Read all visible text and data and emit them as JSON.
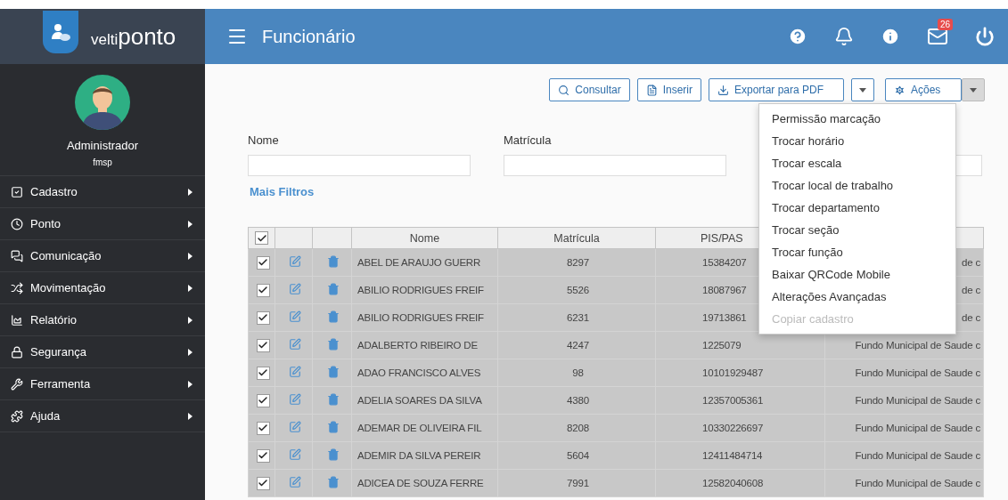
{
  "brand": {
    "prefix": "velti",
    "name": "ponto"
  },
  "user": {
    "name": "Administrador",
    "org": "fmsp"
  },
  "sidebar": {
    "items": [
      {
        "label": "Cadastro"
      },
      {
        "label": "Ponto"
      },
      {
        "label": "Comunicação"
      },
      {
        "label": "Movimentação"
      },
      {
        "label": "Relatório"
      },
      {
        "label": "Segurança"
      },
      {
        "label": "Ferramenta"
      },
      {
        "label": "Ajuda"
      }
    ]
  },
  "header": {
    "title": "Funcionário",
    "mail_badge": "26"
  },
  "toolbar": {
    "buttons": [
      "Consultar",
      "Inserir",
      "Exportar para PDF"
    ],
    "actions": "Ações"
  },
  "filters": [
    {
      "label": "Nome"
    },
    {
      "label": "Matrícula"
    }
  ],
  "more_filters": "Mais Filtros",
  "actions_menu": [
    {
      "label": "Permissão marcação",
      "disabled": false
    },
    {
      "label": "Trocar horário",
      "disabled": false
    },
    {
      "label": "Trocar escala",
      "disabled": false
    },
    {
      "label": "Trocar local de trabalho",
      "disabled": false
    },
    {
      "label": "Trocar departamento",
      "disabled": false
    },
    {
      "label": "Trocar seção",
      "disabled": false
    },
    {
      "label": "Trocar função",
      "disabled": false
    },
    {
      "label": "Baixar QRCode Mobile",
      "disabled": false
    },
    {
      "label": "Alterações Avançadas",
      "disabled": false
    },
    {
      "label": "Copiar cadastro",
      "disabled": true
    }
  ],
  "table": {
    "all_checked": true,
    "columns": [
      "Nome",
      "Matrícula",
      "PIS/PAS"
    ],
    "rows": [
      {
        "checked": true,
        "cells": [
          "ABEL DE ARAUJO GUERR",
          "8297",
          "15384207",
          "de c"
        ]
      },
      {
        "checked": true,
        "cells": [
          "ABILIO RODRIGUES FREIF",
          "5526",
          "18087967",
          "de c"
        ]
      },
      {
        "checked": true,
        "cells": [
          "ABILIO RODRIGUES FREIF",
          "6231",
          "19713861",
          "de c"
        ]
      },
      {
        "checked": true,
        "cells": [
          "ADALBERTO RIBEIRO DE",
          "4247",
          "1225079",
          "Fundo Municipal de Saude c"
        ]
      },
      {
        "checked": true,
        "cells": [
          "ADAO FRANCISCO ALVES",
          "98",
          "10101929487",
          "Fundo Municipal de Saude c"
        ]
      },
      {
        "checked": true,
        "cells": [
          "ADELIA SOARES DA SILVA",
          "4380",
          "12357005361",
          "Fundo Municipal de Saude c"
        ]
      },
      {
        "checked": true,
        "cells": [
          "ADEMAR DE OLIVEIRA FIL",
          "8208",
          "10330226697",
          "Fundo Municipal de Saude c"
        ]
      },
      {
        "checked": true,
        "cells": [
          "ADEMIR DA SILVA PEREIR",
          "5604",
          "12411484714",
          "Fundo Municipal de Saude c"
        ]
      },
      {
        "checked": true,
        "cells": [
          "ADICEA DE SOUZA FERRE",
          "7991",
          "12582040608",
          "Fundo Municipal de Saude c"
        ]
      }
    ]
  }
}
